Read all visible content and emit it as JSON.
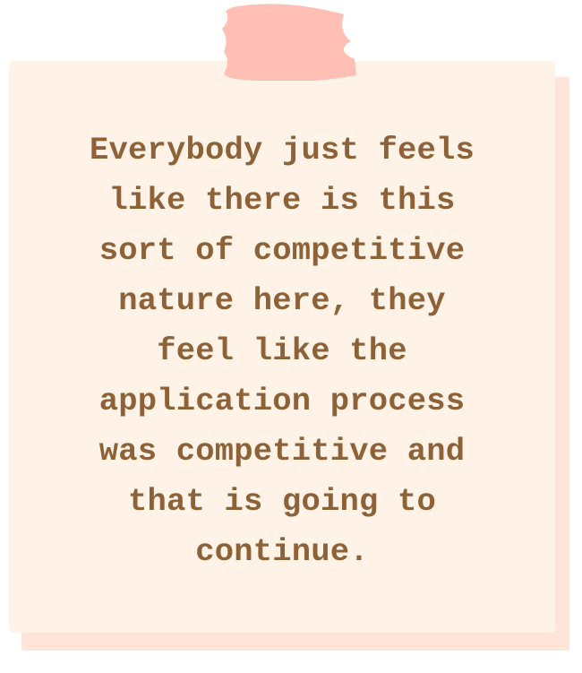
{
  "note": {
    "quote": "Everybody just feels\nlike there is this\nsort of competitive\nnature here, they\nfeel like the\napplication process\nwas competitive and\nthat is going to\ncontinue. ",
    "colors": {
      "paper": "#fef3e6",
      "shadow": "#ffe4da",
      "tape": "#ffbfb4",
      "text": "#8e6239"
    },
    "tape_icon": "washi-tape-icon"
  }
}
